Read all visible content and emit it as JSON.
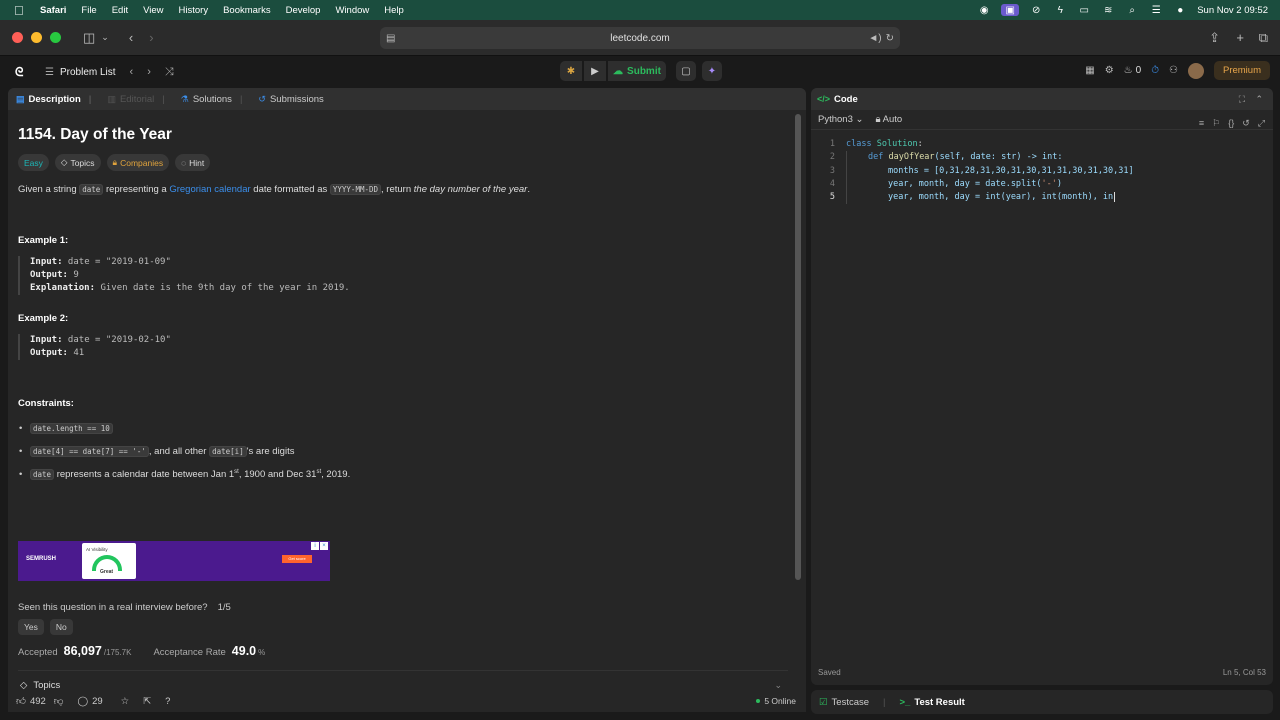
{
  "menubar": {
    "app": "Safari",
    "items": [
      "File",
      "Edit",
      "View",
      "History",
      "Bookmarks",
      "Develop",
      "Window",
      "Help"
    ],
    "clock": "Sun Nov 2  09:52"
  },
  "browser": {
    "url": "leetcode.com"
  },
  "lc_top": {
    "problem_list": "Problem List",
    "submit": "Submit",
    "streak": "0",
    "premium": "Premium"
  },
  "left": {
    "tabs": {
      "description": "Description",
      "editorial": "Editorial",
      "solutions": "Solutions",
      "submissions": "Submissions"
    },
    "title": "1154. Day of the Year",
    "chips": {
      "easy": "Easy",
      "topics": "Topics",
      "companies": "Companies",
      "hint": "Hint"
    },
    "desc": {
      "p1": "Given a string ",
      "code1": "date",
      "p2": " representing a ",
      "link": "Gregorian calendar",
      "p3": " date formatted as ",
      "code2": "YYYY-MM-DD",
      "p4": ", return ",
      "em": "the day number of the year",
      "p5": "."
    },
    "ex1": {
      "heading": "Example 1:",
      "input_label": "Input:",
      "input": " date = \"2019-01-09\"",
      "output_label": "Output:",
      "output": " 9",
      "expl_label": "Explanation:",
      "expl": " Given date is the 9th day of the year in 2019."
    },
    "ex2": {
      "heading": "Example 2:",
      "input_label": "Input:",
      "input": " date = \"2019-02-10\"",
      "output_label": "Output:",
      "output": " 41"
    },
    "constraints": {
      "heading": "Constraints:",
      "c1": "date.length == 10",
      "c2a": "date[4] == date[7] == '-'",
      "c2b": ", and all other ",
      "c2c": "date[i]",
      "c2d": "'s are digits",
      "c3a": "date",
      "c3b": " represents a calendar date between Jan 1",
      "c3sup1": "st",
      "c3c": ", 1900 and Dec 31",
      "c3sup2": "st",
      "c3d": ", 2019."
    },
    "ad": {
      "brand": "SEMRUSH",
      "card_title": "AI Visibility",
      "score": "Great",
      "cta": "Get score"
    },
    "seen": "Seen this question in a real interview before?",
    "seen_count": "1/5",
    "yes": "Yes",
    "no": "No",
    "accepted_label": "Accepted",
    "accepted": "86,097",
    "accepted_total": "/175.7K",
    "rate_label": "Acceptance Rate",
    "rate": "49.0",
    "rate_unit": "%",
    "topics": "Topics",
    "likes": "492",
    "comments": "29",
    "online": "5 Online"
  },
  "right": {
    "code_tab": "Code",
    "lang": "Python3",
    "auto": "Auto",
    "saved": "Saved",
    "cursor": "Ln 5, Col 53",
    "testcase": "Testcase",
    "test_result": "Test Result"
  },
  "code_lines": [
    {
      "n": "1"
    },
    {
      "n": "2"
    },
    {
      "n": "3"
    },
    {
      "n": "4"
    },
    {
      "n": "5"
    }
  ],
  "code": {
    "l1a": "class ",
    "l1b": "Solution",
    "l1c": ":",
    "l2a": "def ",
    "l2b": "dayOfYear",
    "l2c": "(self, date: str) -> int:",
    "l3a": "months = [0,31,28,31,30,31,30,31,31,30,31,30,31]",
    "l4a": "year, month, day = date.split(",
    "l4b": "'-'",
    "l4c": ")",
    "l5a": "year, month, day = int(year), int(month), in"
  }
}
